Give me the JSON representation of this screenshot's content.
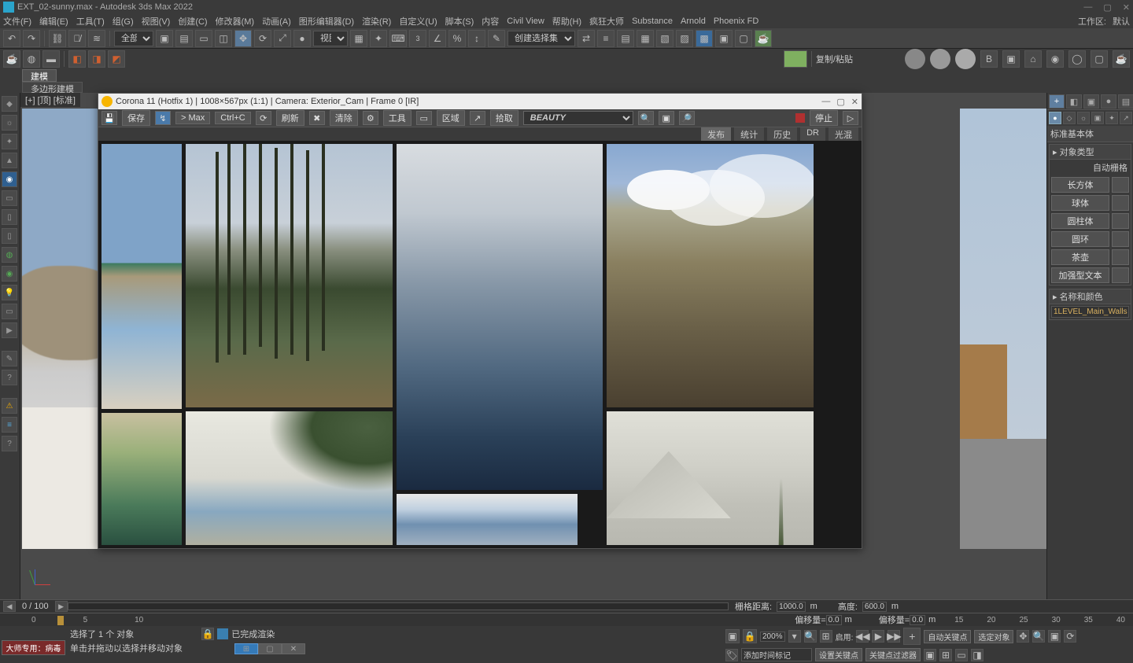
{
  "titlebar": {
    "text": "EXT_02-sunny.max - Autodesk 3ds Max 2022"
  },
  "menubar": {
    "items": [
      "文件(F)",
      "编辑(E)",
      "工具(T)",
      "组(G)",
      "视图(V)",
      "创建(C)",
      "修改器(M)",
      "动画(A)",
      "图形编辑器(D)",
      "渲染(R)",
      "自定义(U)",
      "脚本(S)",
      "内容",
      "Civil View",
      "帮助(H)",
      "疯狂大师",
      "Substance",
      "Arnold",
      "Phoenix FD"
    ],
    "right": [
      "工作区:",
      "默认"
    ]
  },
  "toolbar": {
    "select_filter": "全部",
    "view_dd": "视图",
    "named_sel": "创建选择集"
  },
  "toolbar2": {
    "label": "复制/粘贴"
  },
  "ribbon": {
    "t1": "建模",
    "t2": "多边形建模"
  },
  "viewport_label": "[+] [顶] [标准]",
  "corona": {
    "title": "Corona 11 (Hotfix 1) | 1008×567px (1:1) | Camera: Exterior_Cam | Frame 0 [IR]",
    "btn_save": "保存",
    "btn_max": "> Max",
    "btn_ctrlc": "Ctrl+C",
    "btn_refresh": "刷新",
    "btn_clear": "清除",
    "btn_tools": "工具",
    "btn_region": "区域",
    "btn_pick": "拾取",
    "channel": "BEAUTY",
    "btn_stop": "停止",
    "tabs": [
      "发布",
      "统计",
      "历史",
      "DR",
      "光混"
    ],
    "active_tab": 0
  },
  "cmd": {
    "dd_category": "标准基本体",
    "sec_object_type": "对象类型",
    "auto_grid": "自动栅格",
    "buttons": [
      "长方体",
      "球体",
      "圆柱体",
      "圆环",
      "茶壶",
      "加强型文本"
    ],
    "sec_name_color": "名称和颜色",
    "obj_name": "1LEVEL_Main_Walls"
  },
  "time": {
    "frame_counter": "0   /  100",
    "ticks": [
      "0",
      "5",
      "10"
    ],
    "ticks_right": [
      "15",
      "20",
      "25",
      "30",
      "35",
      "40"
    ]
  },
  "grid_info": {
    "grid_label": "栅格距离:",
    "grid_val": "1000.0",
    "grid_unit": "m",
    "height_label": "高度:",
    "height_val": "600.0",
    "offset_label": "偏移量=",
    "offset_x": "0.0",
    "offset_y": "偏移量=",
    "offset_y_val": "0.0"
  },
  "status": {
    "line1": "选择了 1 个 对象",
    "line2": "单击并拖动以选择并移动对象",
    "render_done": "已完成渲染",
    "master_label": "大师专用：病毒"
  },
  "right_status": {
    "zoom": "200%",
    "enable": "启用:",
    "autokey": "自动关键点",
    "sel_obj": "选定对象",
    "add_marker": "添加时间标记",
    "set_key": "设置关键点",
    "key_filter": "关键点过滤器"
  }
}
